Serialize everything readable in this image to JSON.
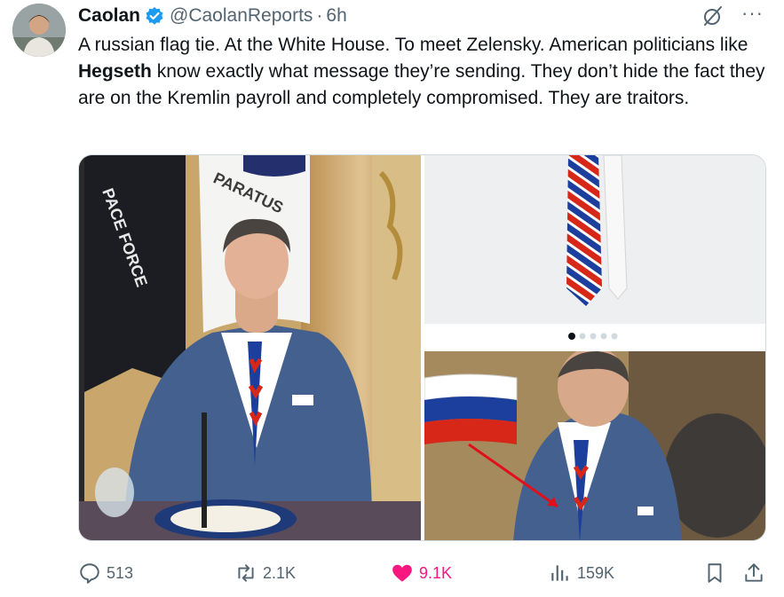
{
  "tweet": {
    "display_name": "Caolan",
    "handle": "@CaolanReports",
    "separator": "·",
    "time": "6h",
    "text_before": "A russian flag tie. At the White House. To meet Zelensky. American politicians like ",
    "text_bold": "Hegseth",
    "text_after": " know exactly what message they’re sending. They don’t hide the fact they are on the Kremlin payroll and completely compromised. They are traitors.",
    "more_label": "···"
  },
  "media": {
    "left_flag_text": "PACE FORCE",
    "banner_text": "PARATUS",
    "carousel_active_index": 0,
    "carousel_dots": 5,
    "colors": {
      "flag_white": "#ffffff",
      "flag_blue": "#1c3f9e",
      "flag_red": "#d62718",
      "suit": "#44608f",
      "curtain": "#c9a66b"
    }
  },
  "actions": {
    "replies": "513",
    "reposts": "2.1K",
    "likes": "9.1K",
    "views": "159K"
  },
  "colors": {
    "secondary_text": "#536471",
    "verified_blue": "#1d9bf0",
    "like_pink": "#f91880"
  }
}
